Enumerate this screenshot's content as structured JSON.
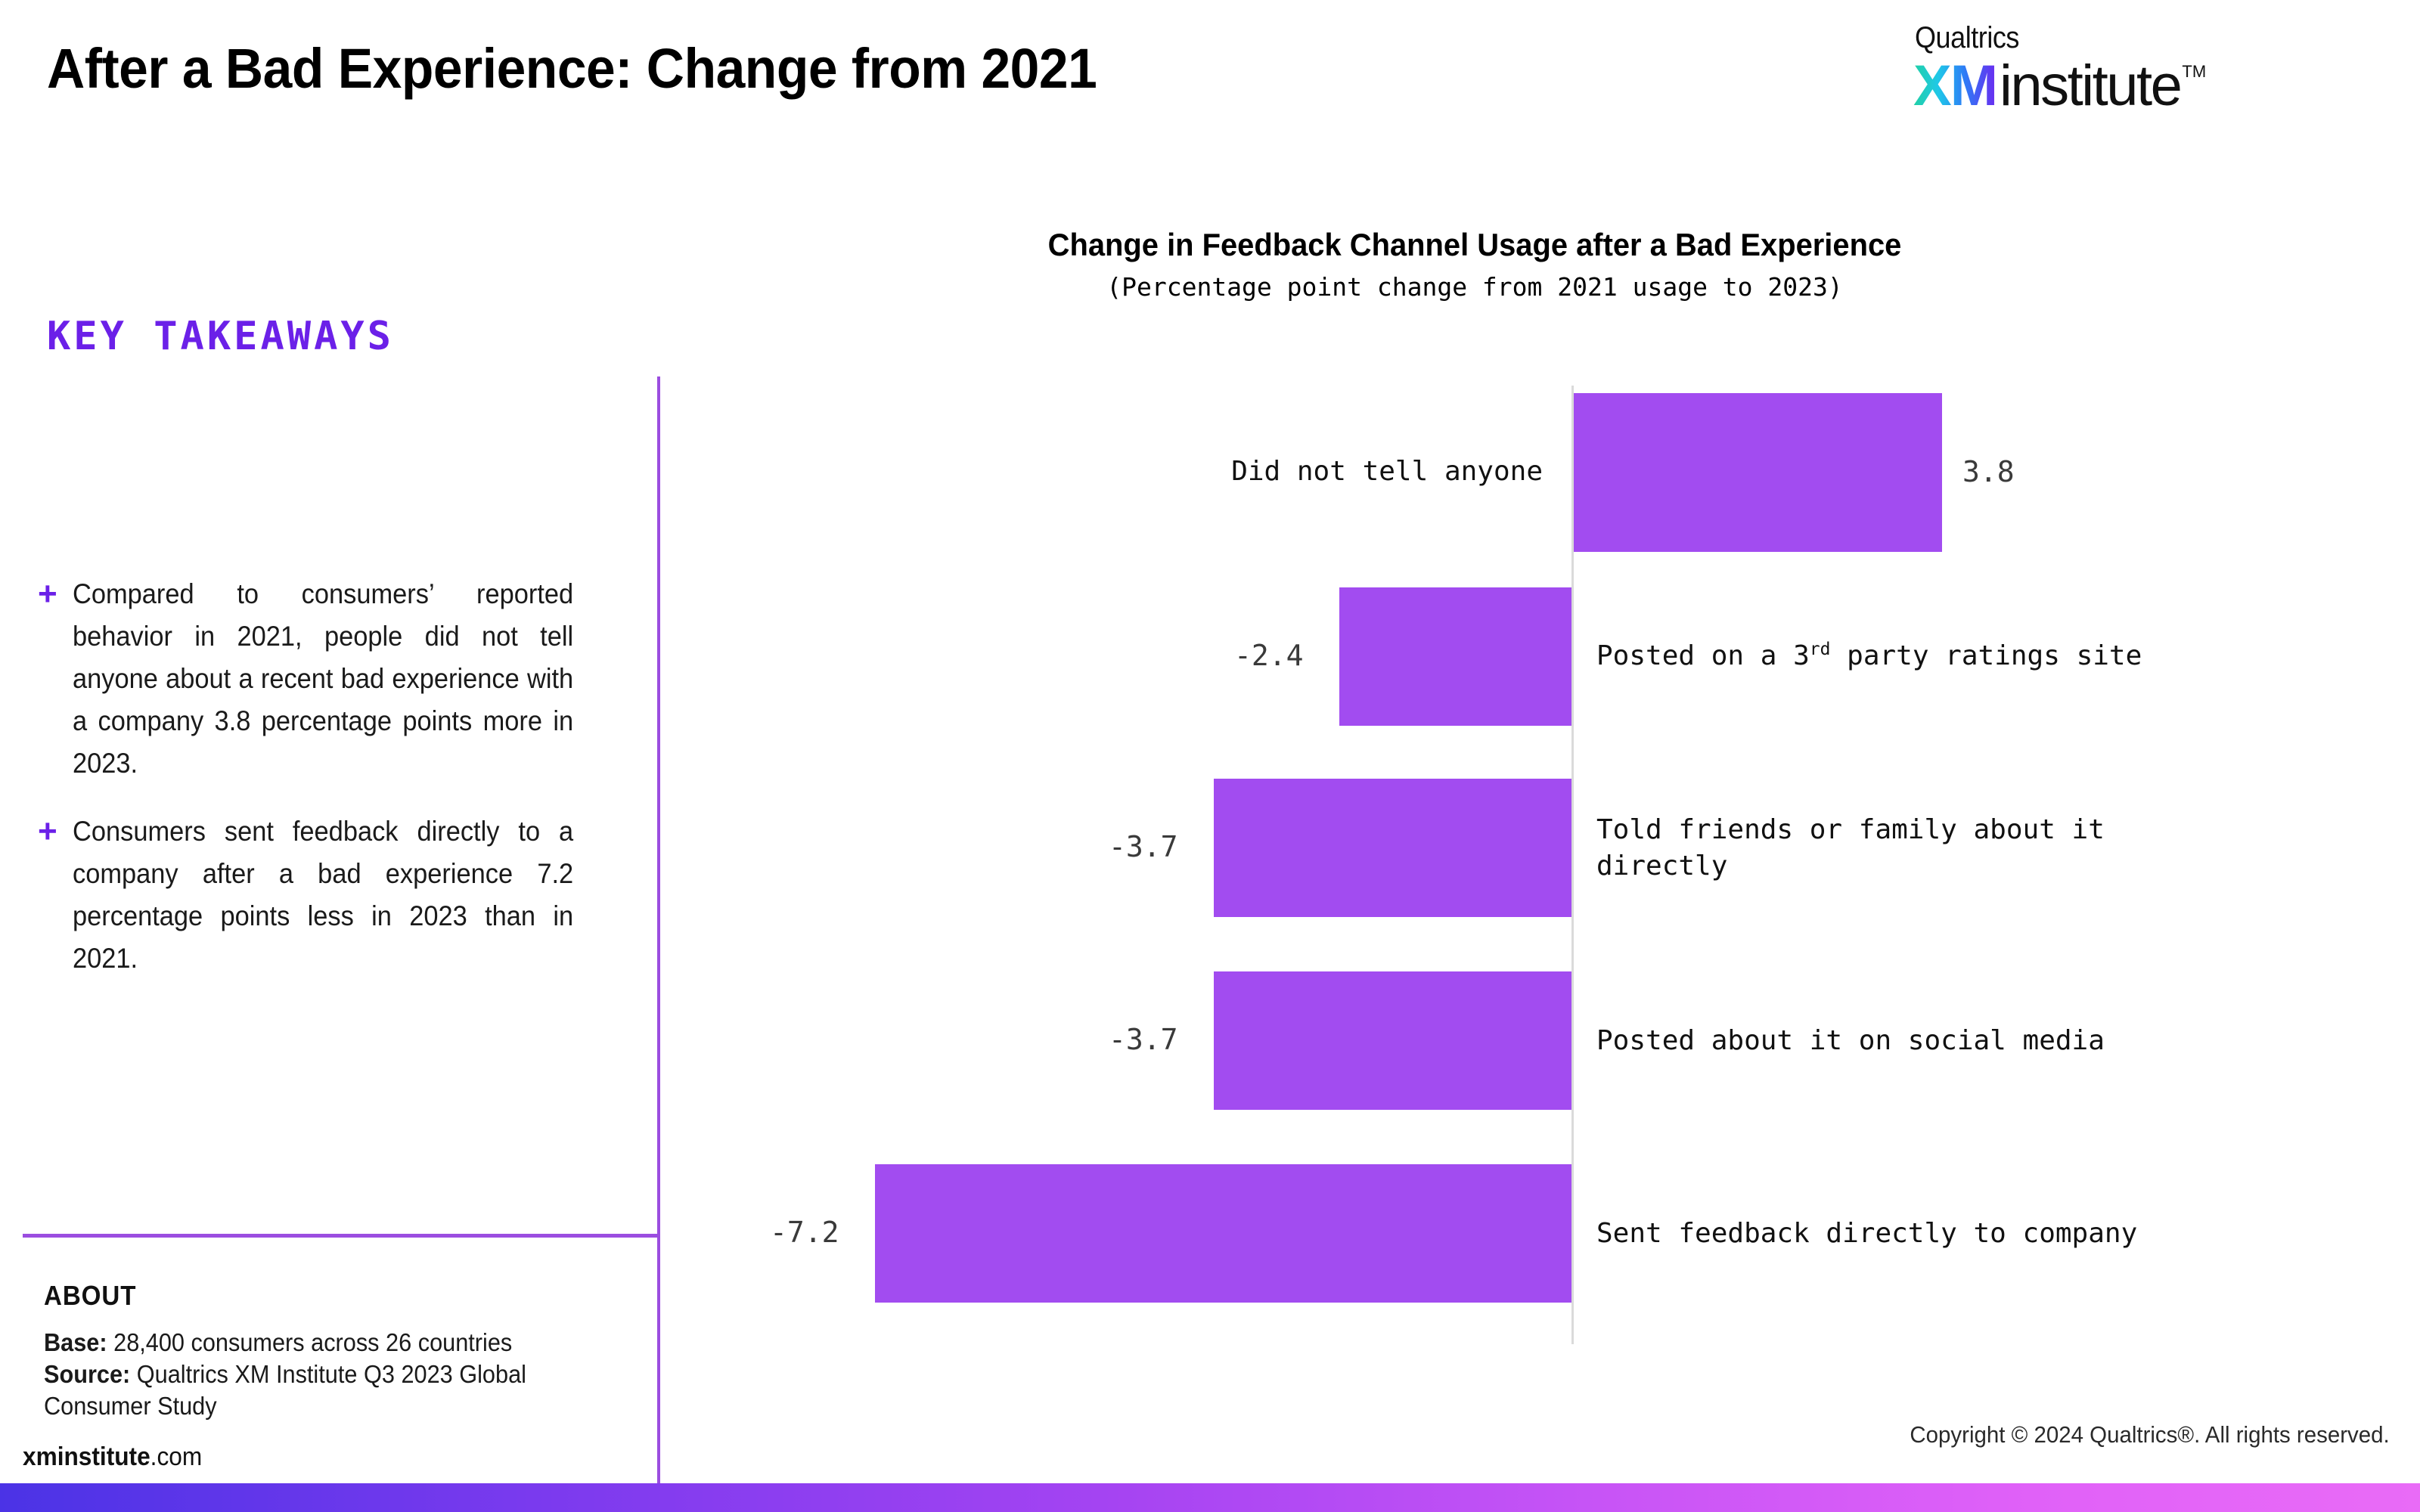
{
  "header": {
    "title": "After a Bad Experience: Change from 2021"
  },
  "logo": {
    "qualtrics": "Qualtrics",
    "xm": "XM",
    "institute": "institute",
    "tm": "TM",
    "gradient_start": "#21D0A5",
    "gradient_end": "#6B2BF0"
  },
  "sidebar": {
    "key_takeaways_heading": "KEY TAKEAWAYS",
    "bullet_marker": "+",
    "bullets": [
      "Compared to consumers’ reported behavior in 2021, people did not tell anyone about a recent bad experience with a company 3.8 percentage points more in 2023.",
      "Consumers sent feedback directly to a company after a bad experience 7.2 percentage points less in 2023 than in 2021."
    ],
    "about_heading": "ABOUT",
    "about_base_label": "Base:",
    "about_base_value": " 28,400 consumers across 26 countries",
    "about_source_label": "Source:",
    "about_source_value": " Qualtrics XM Institute Q3 2023 Global Consumer Study",
    "website_bold": "xminstitute",
    "website_rest": ".com",
    "accent_color": "#6B20E8",
    "divider_color": "#9B4DE0"
  },
  "footer": {
    "copyright": "Copyright © 2024 Qualtrics®. All rights reserved."
  },
  "chart_data": {
    "type": "bar",
    "orientation": "horizontal",
    "title": "Change in Feedback Channel Usage after a Bad Experience",
    "subtitle": "(Percentage point change from 2021 usage to 2023)",
    "xlabel": "",
    "ylabel": "",
    "grid": false,
    "legend": null,
    "bar_color": "#A24CF0",
    "axis_color": "#DADADA",
    "xlim": [
      -8,
      5
    ],
    "categories": [
      "Did not tell anyone",
      "Posted on a 3rd party ratings site",
      "Told friends or family about it directly",
      "Posted about it on social media",
      "Sent feedback directly to company"
    ],
    "values": [
      3.8,
      -2.4,
      -3.7,
      -3.7,
      -7.2
    ],
    "value_labels": [
      "3.8",
      "-2.4",
      "-3.7",
      "-3.7",
      "-7.2"
    ],
    "bars": [
      {
        "label": "Did not tell anyone",
        "label_line1": "Did not tell anyone",
        "label_line2": "",
        "value": 3.8,
        "value_label": "3.8"
      },
      {
        "label": "Posted on a 3rd party ratings site",
        "label_line1": "Posted on a 3",
        "label_sup": "rd",
        "label_line2": " party ratings site",
        "value": -2.4,
        "value_label": "-2.4"
      },
      {
        "label": "Told friends or family about it directly",
        "label_line1": "Told friends or family about it",
        "label_line2": "directly",
        "value": -3.7,
        "value_label": "-3.7"
      },
      {
        "label": "Posted about it on social media",
        "label_line1": "Posted about it on social media",
        "label_line2": "",
        "value": -3.7,
        "value_label": "-3.7"
      },
      {
        "label": "Sent feedback directly to company",
        "label_line1": "Sent feedback directly to company",
        "label_line2": "",
        "value": -7.2,
        "value_label": "-7.2"
      }
    ]
  }
}
